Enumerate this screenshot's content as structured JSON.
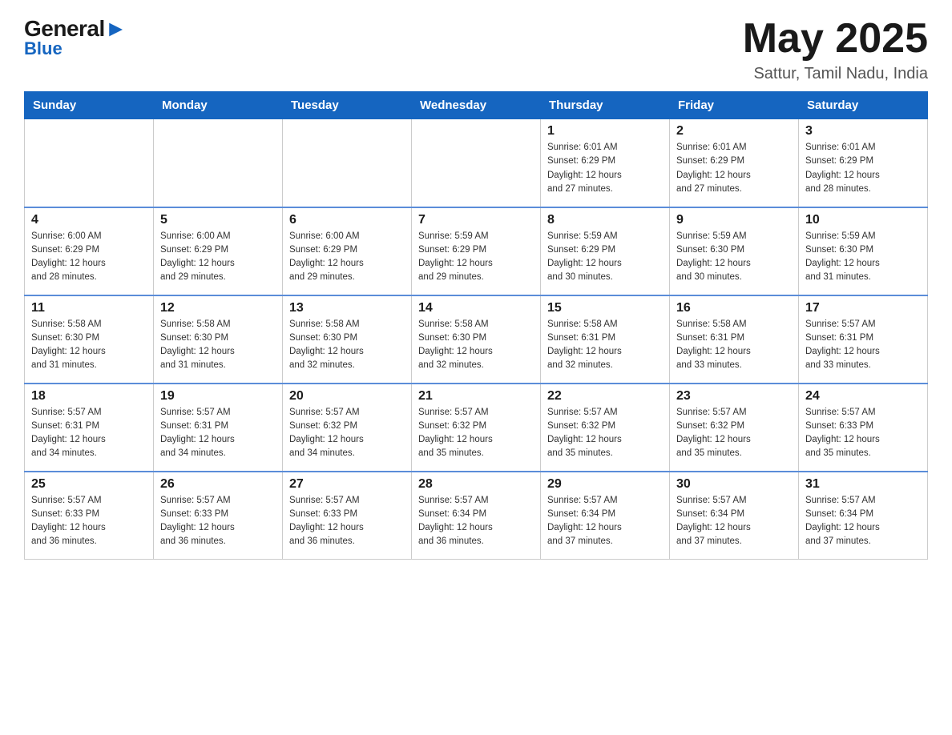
{
  "logo": {
    "general": "General",
    "arrow": "▶",
    "blue": "Blue"
  },
  "header": {
    "month_year": "May 2025",
    "location": "Sattur, Tamil Nadu, India"
  },
  "days_of_week": [
    "Sunday",
    "Monday",
    "Tuesday",
    "Wednesday",
    "Thursday",
    "Friday",
    "Saturday"
  ],
  "weeks": [
    [
      {
        "day": "",
        "info": ""
      },
      {
        "day": "",
        "info": ""
      },
      {
        "day": "",
        "info": ""
      },
      {
        "day": "",
        "info": ""
      },
      {
        "day": "1",
        "info": "Sunrise: 6:01 AM\nSunset: 6:29 PM\nDaylight: 12 hours\nand 27 minutes."
      },
      {
        "day": "2",
        "info": "Sunrise: 6:01 AM\nSunset: 6:29 PM\nDaylight: 12 hours\nand 27 minutes."
      },
      {
        "day": "3",
        "info": "Sunrise: 6:01 AM\nSunset: 6:29 PM\nDaylight: 12 hours\nand 28 minutes."
      }
    ],
    [
      {
        "day": "4",
        "info": "Sunrise: 6:00 AM\nSunset: 6:29 PM\nDaylight: 12 hours\nand 28 minutes."
      },
      {
        "day": "5",
        "info": "Sunrise: 6:00 AM\nSunset: 6:29 PM\nDaylight: 12 hours\nand 29 minutes."
      },
      {
        "day": "6",
        "info": "Sunrise: 6:00 AM\nSunset: 6:29 PM\nDaylight: 12 hours\nand 29 minutes."
      },
      {
        "day": "7",
        "info": "Sunrise: 5:59 AM\nSunset: 6:29 PM\nDaylight: 12 hours\nand 29 minutes."
      },
      {
        "day": "8",
        "info": "Sunrise: 5:59 AM\nSunset: 6:29 PM\nDaylight: 12 hours\nand 30 minutes."
      },
      {
        "day": "9",
        "info": "Sunrise: 5:59 AM\nSunset: 6:30 PM\nDaylight: 12 hours\nand 30 minutes."
      },
      {
        "day": "10",
        "info": "Sunrise: 5:59 AM\nSunset: 6:30 PM\nDaylight: 12 hours\nand 31 minutes."
      }
    ],
    [
      {
        "day": "11",
        "info": "Sunrise: 5:58 AM\nSunset: 6:30 PM\nDaylight: 12 hours\nand 31 minutes."
      },
      {
        "day": "12",
        "info": "Sunrise: 5:58 AM\nSunset: 6:30 PM\nDaylight: 12 hours\nand 31 minutes."
      },
      {
        "day": "13",
        "info": "Sunrise: 5:58 AM\nSunset: 6:30 PM\nDaylight: 12 hours\nand 32 minutes."
      },
      {
        "day": "14",
        "info": "Sunrise: 5:58 AM\nSunset: 6:30 PM\nDaylight: 12 hours\nand 32 minutes."
      },
      {
        "day": "15",
        "info": "Sunrise: 5:58 AM\nSunset: 6:31 PM\nDaylight: 12 hours\nand 32 minutes."
      },
      {
        "day": "16",
        "info": "Sunrise: 5:58 AM\nSunset: 6:31 PM\nDaylight: 12 hours\nand 33 minutes."
      },
      {
        "day": "17",
        "info": "Sunrise: 5:57 AM\nSunset: 6:31 PM\nDaylight: 12 hours\nand 33 minutes."
      }
    ],
    [
      {
        "day": "18",
        "info": "Sunrise: 5:57 AM\nSunset: 6:31 PM\nDaylight: 12 hours\nand 34 minutes."
      },
      {
        "day": "19",
        "info": "Sunrise: 5:57 AM\nSunset: 6:31 PM\nDaylight: 12 hours\nand 34 minutes."
      },
      {
        "day": "20",
        "info": "Sunrise: 5:57 AM\nSunset: 6:32 PM\nDaylight: 12 hours\nand 34 minutes."
      },
      {
        "day": "21",
        "info": "Sunrise: 5:57 AM\nSunset: 6:32 PM\nDaylight: 12 hours\nand 35 minutes."
      },
      {
        "day": "22",
        "info": "Sunrise: 5:57 AM\nSunset: 6:32 PM\nDaylight: 12 hours\nand 35 minutes."
      },
      {
        "day": "23",
        "info": "Sunrise: 5:57 AM\nSunset: 6:32 PM\nDaylight: 12 hours\nand 35 minutes."
      },
      {
        "day": "24",
        "info": "Sunrise: 5:57 AM\nSunset: 6:33 PM\nDaylight: 12 hours\nand 35 minutes."
      }
    ],
    [
      {
        "day": "25",
        "info": "Sunrise: 5:57 AM\nSunset: 6:33 PM\nDaylight: 12 hours\nand 36 minutes."
      },
      {
        "day": "26",
        "info": "Sunrise: 5:57 AM\nSunset: 6:33 PM\nDaylight: 12 hours\nand 36 minutes."
      },
      {
        "day": "27",
        "info": "Sunrise: 5:57 AM\nSunset: 6:33 PM\nDaylight: 12 hours\nand 36 minutes."
      },
      {
        "day": "28",
        "info": "Sunrise: 5:57 AM\nSunset: 6:34 PM\nDaylight: 12 hours\nand 36 minutes."
      },
      {
        "day": "29",
        "info": "Sunrise: 5:57 AM\nSunset: 6:34 PM\nDaylight: 12 hours\nand 37 minutes."
      },
      {
        "day": "30",
        "info": "Sunrise: 5:57 AM\nSunset: 6:34 PM\nDaylight: 12 hours\nand 37 minutes."
      },
      {
        "day": "31",
        "info": "Sunrise: 5:57 AM\nSunset: 6:34 PM\nDaylight: 12 hours\nand 37 minutes."
      }
    ]
  ]
}
